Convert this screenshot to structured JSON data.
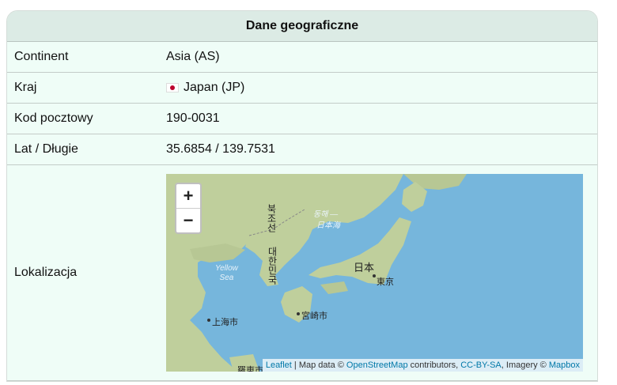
{
  "header": {
    "title": "Dane geograficzne"
  },
  "rows": [
    {
      "key": "Continent",
      "value": "Asia (AS)"
    },
    {
      "key": "Kraj",
      "value": "Japan (JP)"
    },
    {
      "key": "Kod pocztowy",
      "value": "190-0031"
    },
    {
      "key": "Lat / Długie",
      "value": "35.6854 / 139.7531"
    },
    {
      "key": "Lokalizacja"
    }
  ],
  "map": {
    "zoom_in": "+",
    "zoom_out": "−",
    "labels": {
      "north_korea": "북조선",
      "south_korea": "대한민국",
      "sea_of_japan_ko": "동해 —",
      "sea_of_japan_ja": "日本海",
      "japan": "日本",
      "tokyo": "東京",
      "yellow_sea": "Yellow\nSea",
      "shanghai": "上海市",
      "miyazaki": "宮崎市",
      "taiwan_partial": "羅東市"
    },
    "attribution": {
      "leaflet": "Leaflet",
      "sep": " | Map data © ",
      "osm": "OpenStreetMap",
      "contributors": " contributors, ",
      "license": "CC-BY-SA",
      "imagery": ", Imagery © ",
      "mapbox": "Mapbox"
    },
    "colors": {
      "water": "#76b6dc",
      "land": "#bfcf9c",
      "land_dark": "#a9b98a"
    }
  }
}
